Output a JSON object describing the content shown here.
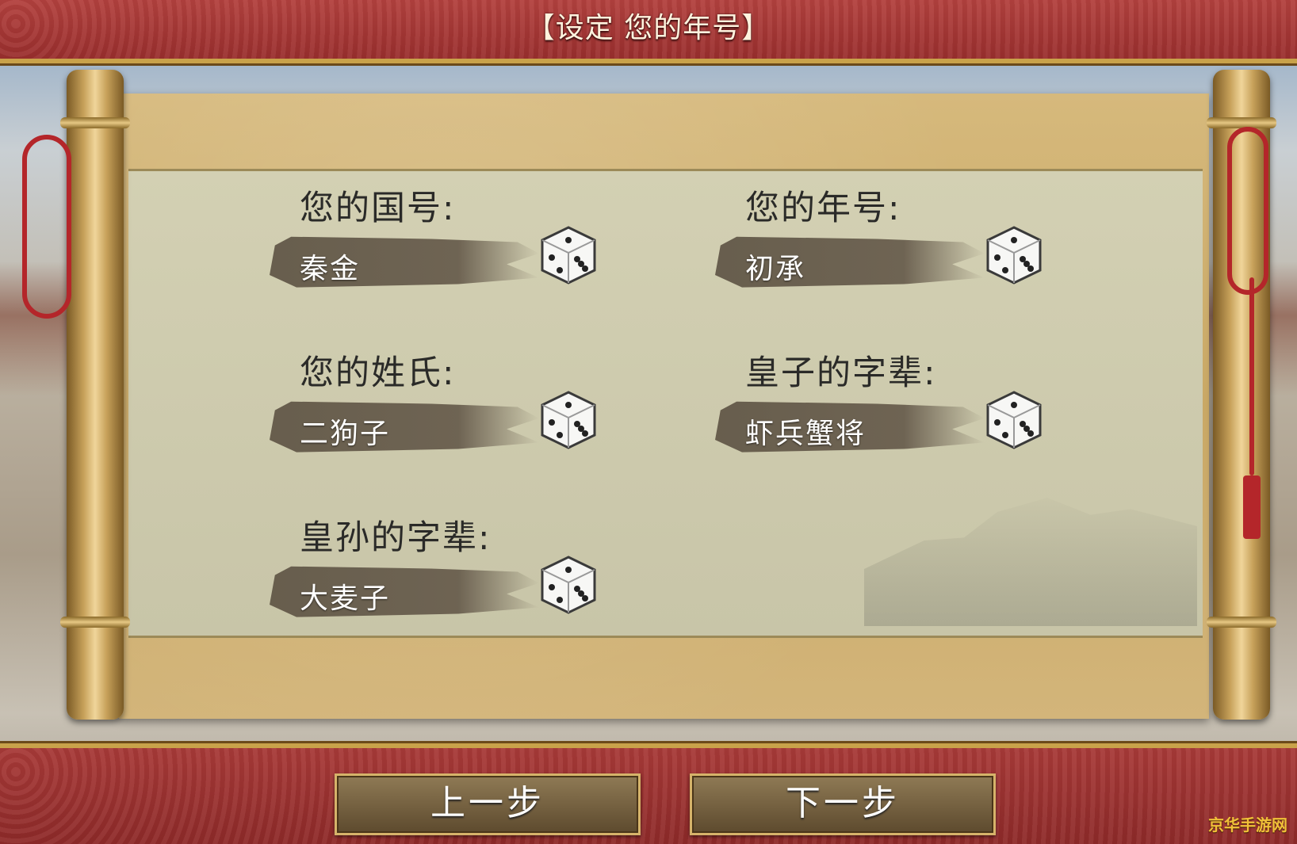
{
  "header": {
    "title": "【设定 您的年号】"
  },
  "fields": [
    {
      "label": "您的国号:",
      "value": "秦金"
    },
    {
      "label": "您的年号:",
      "value": "初承"
    },
    {
      "label": "您的姓氏:",
      "value": "二狗子"
    },
    {
      "label": "皇子的字辈:",
      "value": "虾兵蟹将"
    },
    {
      "label": "皇孙的字辈:",
      "value": "大麦子"
    }
  ],
  "footer": {
    "prev_label": "上一步",
    "next_label": "下一步"
  },
  "watermark": "京华手游网",
  "icons": {
    "dice": "dice-icon"
  },
  "colors": {
    "banner": "#a83a38",
    "gold": "#c9a24a",
    "parchment": "#d3d0b3"
  }
}
